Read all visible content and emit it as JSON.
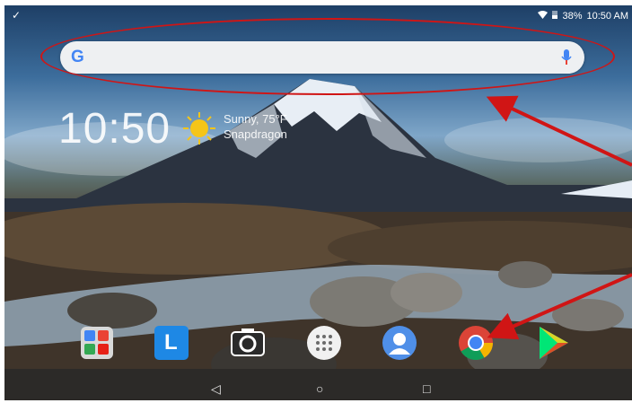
{
  "status_bar": {
    "notification_icon": "download-done-icon",
    "battery": "38%",
    "time": "10:50 AM",
    "wifi_icon": "wifi-icon",
    "battery_icon": "battery-icon"
  },
  "search_bar": {
    "logo": "G",
    "mic_icon": "mic-icon"
  },
  "widget": {
    "clock": "10:50",
    "weather_line1": "Sunny, 75°F",
    "weather_line2": "Snapdragon",
    "weather_icon": "sun-icon"
  },
  "dock": {
    "apps": [
      {
        "name": "google-apps-folder",
        "icon": "folder-icon"
      },
      {
        "name": "lenovo-launcher",
        "icon": "l-icon",
        "letter": "L"
      },
      {
        "name": "camera",
        "icon": "camera-icon"
      },
      {
        "name": "app-drawer",
        "icon": "app-drawer-icon"
      },
      {
        "name": "contacts",
        "icon": "contacts-icon"
      },
      {
        "name": "chrome",
        "icon": "chrome-icon"
      },
      {
        "name": "play-store",
        "icon": "play-store-icon"
      }
    ]
  },
  "navigation": {
    "back": "◁",
    "home": "○",
    "recents": "□"
  },
  "annotation_colors": {
    "highlight": "#d01515"
  }
}
